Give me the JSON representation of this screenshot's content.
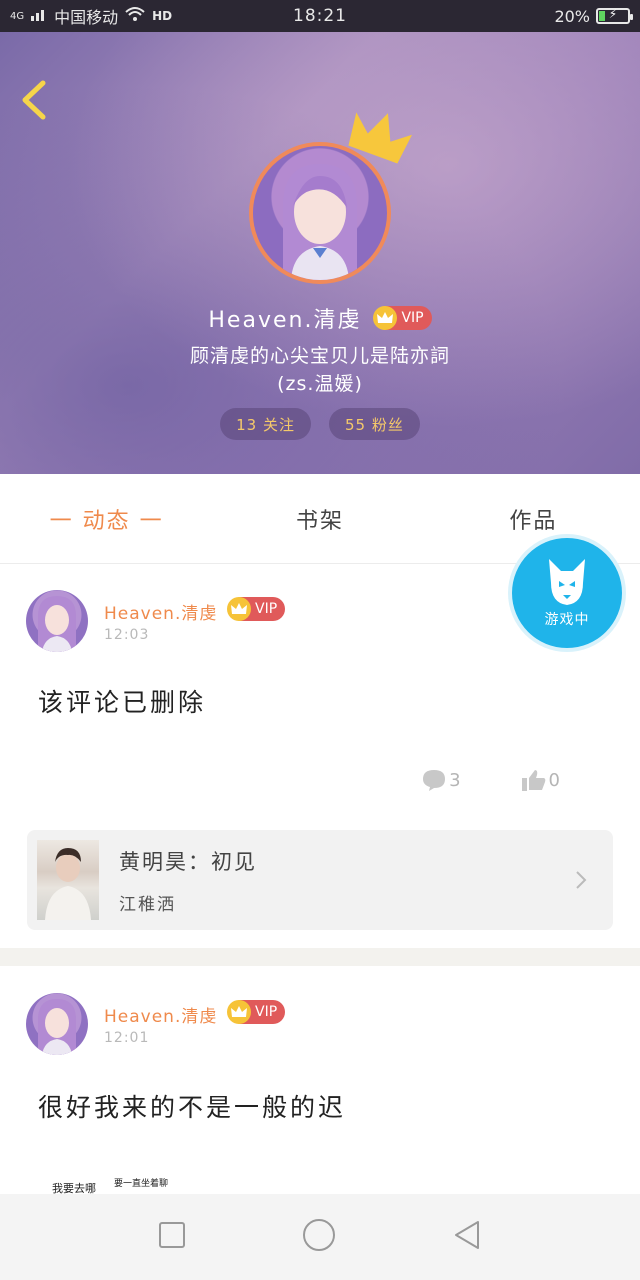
{
  "status_bar": {
    "network": "4G",
    "carrier": "中国移动",
    "hd": "HD",
    "time": "18:21",
    "battery": "20%"
  },
  "profile": {
    "name": "Heaven.清虔",
    "vip": "VIP",
    "signature_line1": "顾清虔的心尖宝贝儿是陆亦詞",
    "signature_line2": "(zs.温媛)",
    "following": "13 关注",
    "followers": "55 粉丝"
  },
  "tabs": [
    {
      "label": "一 动态 一",
      "active": true
    },
    {
      "label": "书架",
      "active": false
    },
    {
      "label": "作品",
      "active": false
    }
  ],
  "game_button": {
    "label": "游戏中"
  },
  "posts": [
    {
      "name": "Heaven.清虔",
      "vip": "VIP",
      "time": "12:03",
      "text": "该评论已删除",
      "comments": "3",
      "likes": "0",
      "book": {
        "title": "黄明昊：初见",
        "author": "江稚洒"
      }
    },
    {
      "name": "Heaven.清虔",
      "vip": "VIP",
      "time": "12:01",
      "text": "很好我来的不是一般的迟"
    }
  ],
  "partial_image_text": {
    "line1": "我要去哪",
    "line2": "要一直坐着聊"
  },
  "colors": {
    "accent": "#ef8a4c",
    "vip_red": "#e05a5a",
    "game_blue": "#1fb4ea",
    "header_purple": "#9a7fb8"
  }
}
